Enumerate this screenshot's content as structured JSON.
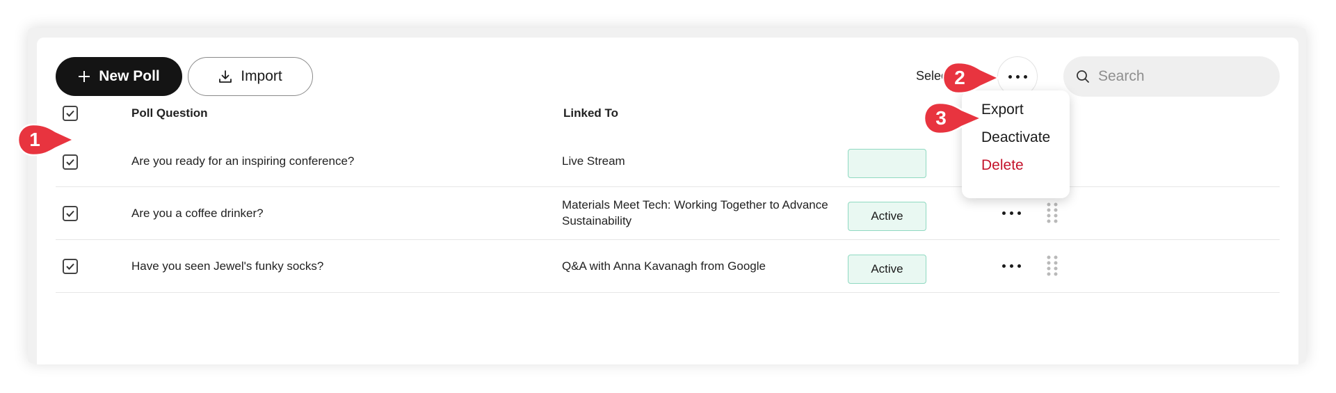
{
  "toolbar": {
    "new_poll_label": "New Poll",
    "import_label": "Import",
    "select_label": "Selec",
    "search_placeholder": "Search"
  },
  "table": {
    "columns": [
      "Poll Question",
      "Linked To"
    ],
    "rows": [
      {
        "question": "Are you ready for an inspiring conference?",
        "linked_to": "Live Stream",
        "status": "",
        "checked": true
      },
      {
        "question": "Are you a coffee drinker?",
        "linked_to_line1": "Materials Meet Tech: Working Together to Advance",
        "linked_to_line2": "Sustainability",
        "status": "Active",
        "checked": true
      },
      {
        "question": "Have you seen Jewel's funky socks?",
        "linked_to": "Q&A with Anna Kavanagh from Google",
        "status": "Active",
        "checked": true
      }
    ]
  },
  "menu": {
    "items": [
      "Export",
      "Deactivate",
      "Delete"
    ]
  },
  "callouts": [
    "1",
    "2",
    "3"
  ],
  "colors": {
    "primary_button": "#141414",
    "callout": "#e8343f",
    "active_badge_bg": "#e9f8f2",
    "active_badge_border": "#8fd9c1",
    "delete_text": "#c4132b"
  },
  "icons": {
    "new_poll": "plus-icon",
    "import": "download-icon",
    "search": "search-icon",
    "more": "more-horizontal-icon",
    "drag": "drag-handle-icon",
    "checkbox": "checkbox-checked-icon"
  }
}
